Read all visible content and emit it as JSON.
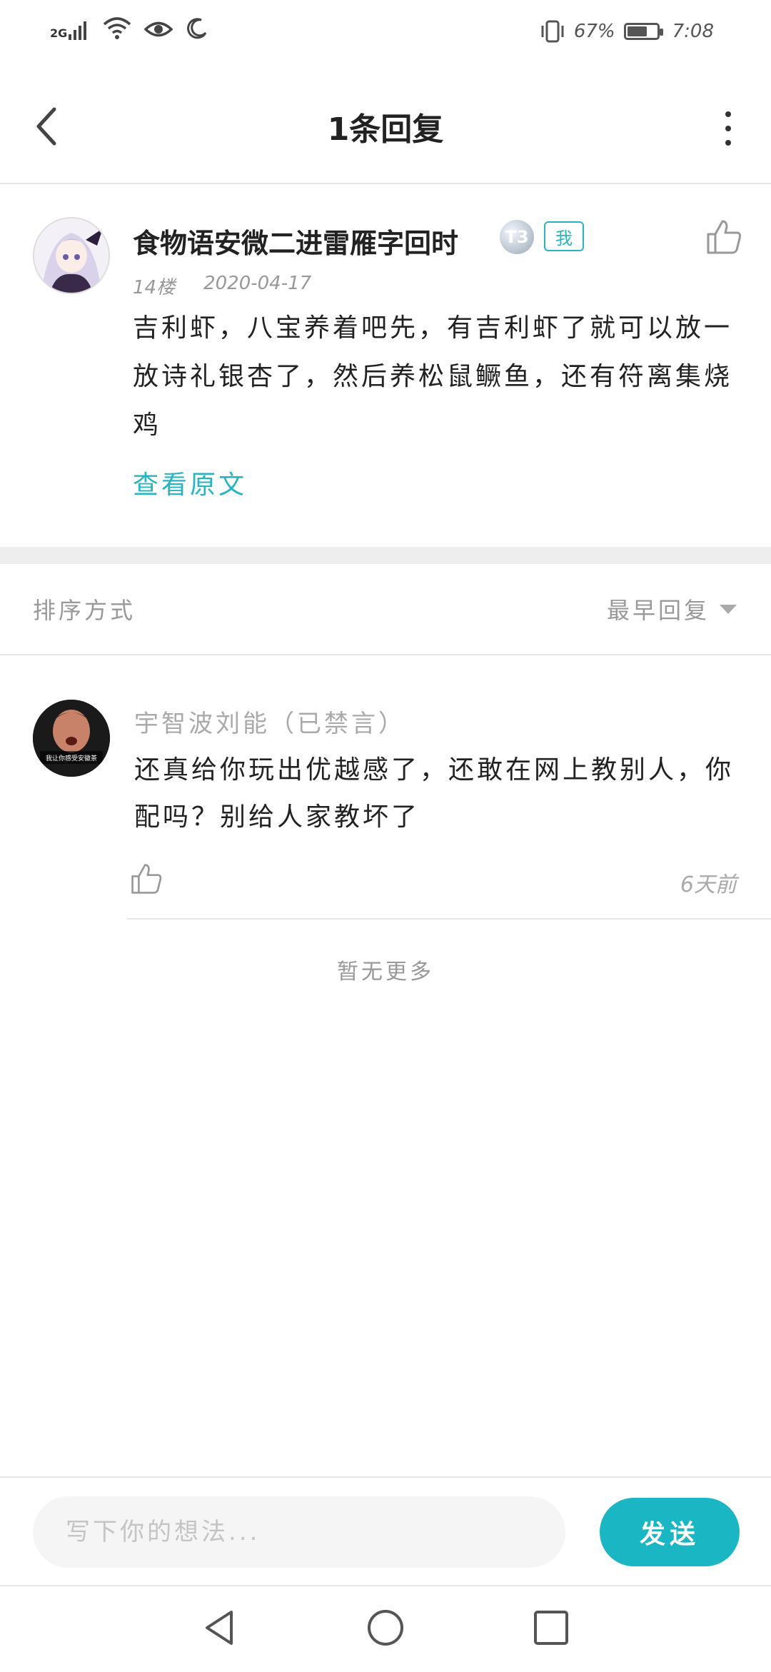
{
  "status_bar": {
    "network_label": "2G",
    "battery_text": "67%",
    "battery_level": 0.67,
    "time": "7:08",
    "icons": [
      "signal-icon",
      "wifi-icon",
      "eye-icon",
      "moon-icon",
      "vibrate-icon",
      "battery-icon"
    ]
  },
  "header": {
    "title": "1条回复",
    "back_icon": "chevron-left-icon",
    "more_icon": "more-vertical-icon"
  },
  "post": {
    "author": "食物语安微二进雷雁字回时",
    "level_badge": "T3",
    "me_badge": "我",
    "floor": "14楼",
    "date": "2020-04-17",
    "content": "吉利虾，八宝养着吧先，有吉利虾了就可以放一放诗礼银杏了，然后养松鼠鳜鱼，还有符离集烧鸡",
    "view_original": "查看原文"
  },
  "sort": {
    "label": "排序方式",
    "selected": "最早回复"
  },
  "replies": [
    {
      "author": "宇智波刘能（已禁言）",
      "content": "还真给你玩出优越感了，还敢在网上教别人，你配吗？别给人家教坏了",
      "time": "6天前",
      "avatar_caption": "我让你感受安徽茶"
    }
  ],
  "footer": {
    "no_more": "暂无更多"
  },
  "input_bar": {
    "placeholder": "写下你的想法...",
    "send_label": "发送"
  },
  "colors": {
    "accent": "#1ab6c4",
    "text": "#222222",
    "muted": "#999999",
    "divider": "#e6e6e6"
  }
}
